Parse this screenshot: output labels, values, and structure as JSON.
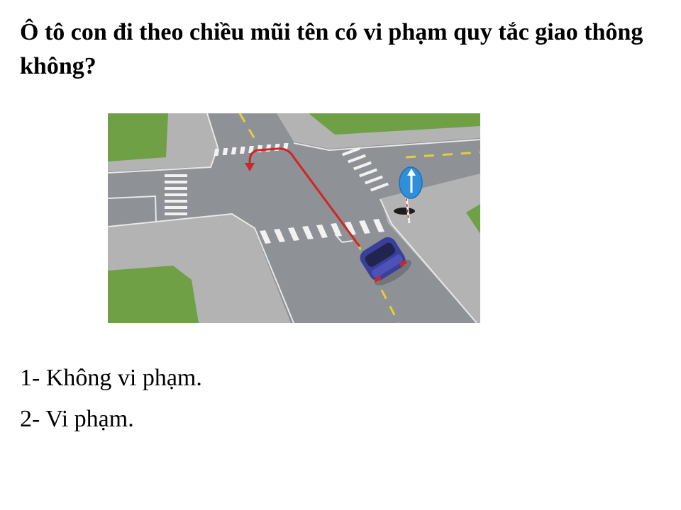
{
  "question": {
    "text": "Ô tô con đi theo chiều mũi tên có vi phạm quy tắc giao thông không?"
  },
  "illustration": {
    "sign_icon": "mandatory-straight-ahead-arrow-sign-icon",
    "vehicle_icon": "blue-sedan-car-icon",
    "path_icon": "red-u-turn-path-arrow-icon",
    "colors": {
      "road": "#8e9196",
      "sidewalk": "#b2b2b2",
      "grass": "#7fae4a",
      "center_line": "#e3cf3a",
      "path": "#d22424",
      "sign": "#2f8fd8",
      "car": "#3a3f9a"
    }
  },
  "answers": [
    {
      "label": "1- Không vi phạm."
    },
    {
      "label": "2- Vi phạm."
    }
  ]
}
